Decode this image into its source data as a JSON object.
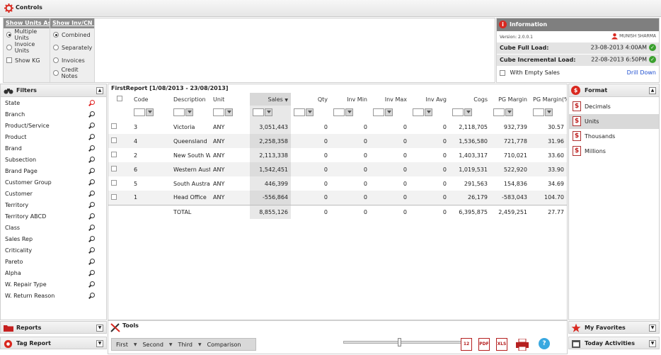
{
  "topbar": {
    "title": "Controls"
  },
  "controls": {
    "units_header": "Show Units As",
    "units_options": [
      "Multiple Units",
      "Invoice Units"
    ],
    "show_kg": "Show KG",
    "inv_header": "Show Inv/CN As",
    "inv_options": [
      "Combined",
      "Separately",
      "Invoices",
      "Credit Notes"
    ]
  },
  "info": {
    "title": "Information",
    "version": "Version: 2.0.0.1",
    "user": "MUNISH SHARMA",
    "full_load_label": "Cube Full Load:",
    "full_load_value": "23-08-2013 4:00AM",
    "incr_load_label": "Cube Incremental Load:",
    "incr_load_value": "22-08-2013 6:50PM",
    "empty_sales": "With Empty Sales",
    "drill_down": "Drill Down"
  },
  "filters": {
    "title": "Filters",
    "items": [
      "State",
      "Branch",
      "Product/Service",
      "Product",
      "Brand",
      "Subsection",
      "Brand Page",
      "Customer Group",
      "Customer",
      "Territory",
      "Territory ABCD",
      "Class",
      "Sales Rep",
      "Criticality",
      "Pareto",
      "Alpha",
      "W. Repair Type",
      "W. Return Reason"
    ]
  },
  "left_bottom": {
    "reports": "Reports",
    "tag_report": "Tag Report"
  },
  "report": {
    "title": "FirstReport [1/08/2013 - 23/08/2013]",
    "columns": [
      "Code",
      "Description",
      "Unit",
      "Sales",
      "Qty",
      "Inv Min",
      "Inv Max",
      "Inv Avg",
      "Cogs",
      "PG Margin",
      "PG Margin(%)"
    ],
    "rows": [
      [
        "3",
        "Victoria",
        "ANY",
        "3,051,443",
        "0",
        "0",
        "0",
        "0",
        "2,118,705",
        "932,739",
        "30.57"
      ],
      [
        "4",
        "Queensland",
        "ANY",
        "2,258,358",
        "0",
        "0",
        "0",
        "0",
        "1,536,580",
        "721,778",
        "31.96"
      ],
      [
        "2",
        "New South Wa",
        "ANY",
        "2,113,338",
        "0",
        "0",
        "0",
        "0",
        "1,403,317",
        "710,021",
        "33.60"
      ],
      [
        "6",
        "Western Austra",
        "ANY",
        "1,542,451",
        "0",
        "0",
        "0",
        "0",
        "1,019,531",
        "522,920",
        "33.90"
      ],
      [
        "5",
        "South Australia",
        "ANY",
        "446,399",
        "0",
        "0",
        "0",
        "0",
        "291,563",
        "154,836",
        "34.69"
      ],
      [
        "1",
        "Head Office",
        "ANY",
        "-556,864",
        "0",
        "0",
        "0",
        "0",
        "26,179",
        "-583,043",
        "104.70"
      ]
    ],
    "total": [
      "TOTAL",
      "8,855,126",
      "0",
      "0",
      "0",
      "0",
      "6,395,875",
      "2,459,251",
      "27.77"
    ]
  },
  "format": {
    "title": "Format",
    "items": [
      "Decimals",
      "Units",
      "Thousands",
      "Millions"
    ],
    "selected": "Units"
  },
  "right_bottom": {
    "favorites": "My Favorites",
    "today": "Today Activities"
  },
  "tools": {
    "title": "Tools",
    "tabs": [
      "First",
      "Second",
      "Third",
      "Comparison"
    ],
    "calendar_day": "12",
    "pdf": "PDF",
    "xls": "XLS",
    "help": "?"
  },
  "colors": {
    "accent_red": "#d9281f",
    "check_green": "#3aa02e",
    "link_blue": "#1f4fcf"
  }
}
